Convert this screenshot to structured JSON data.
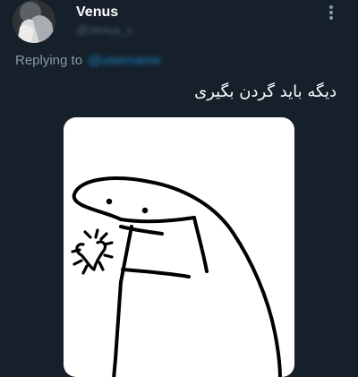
{
  "tweet": {
    "author": {
      "display_name": "Venus",
      "handle": "@Venus_s"
    },
    "replying": {
      "prefix": "Replying to",
      "handle": "@username"
    },
    "text": "دیگه باید گردن بگیری",
    "media": {
      "description_icon": "meme-character-heart-hands"
    }
  },
  "colors": {
    "background": "#15202b",
    "primary_text": "#ffffff",
    "secondary_text": "#8899a6",
    "accent": "#1da1f2"
  }
}
